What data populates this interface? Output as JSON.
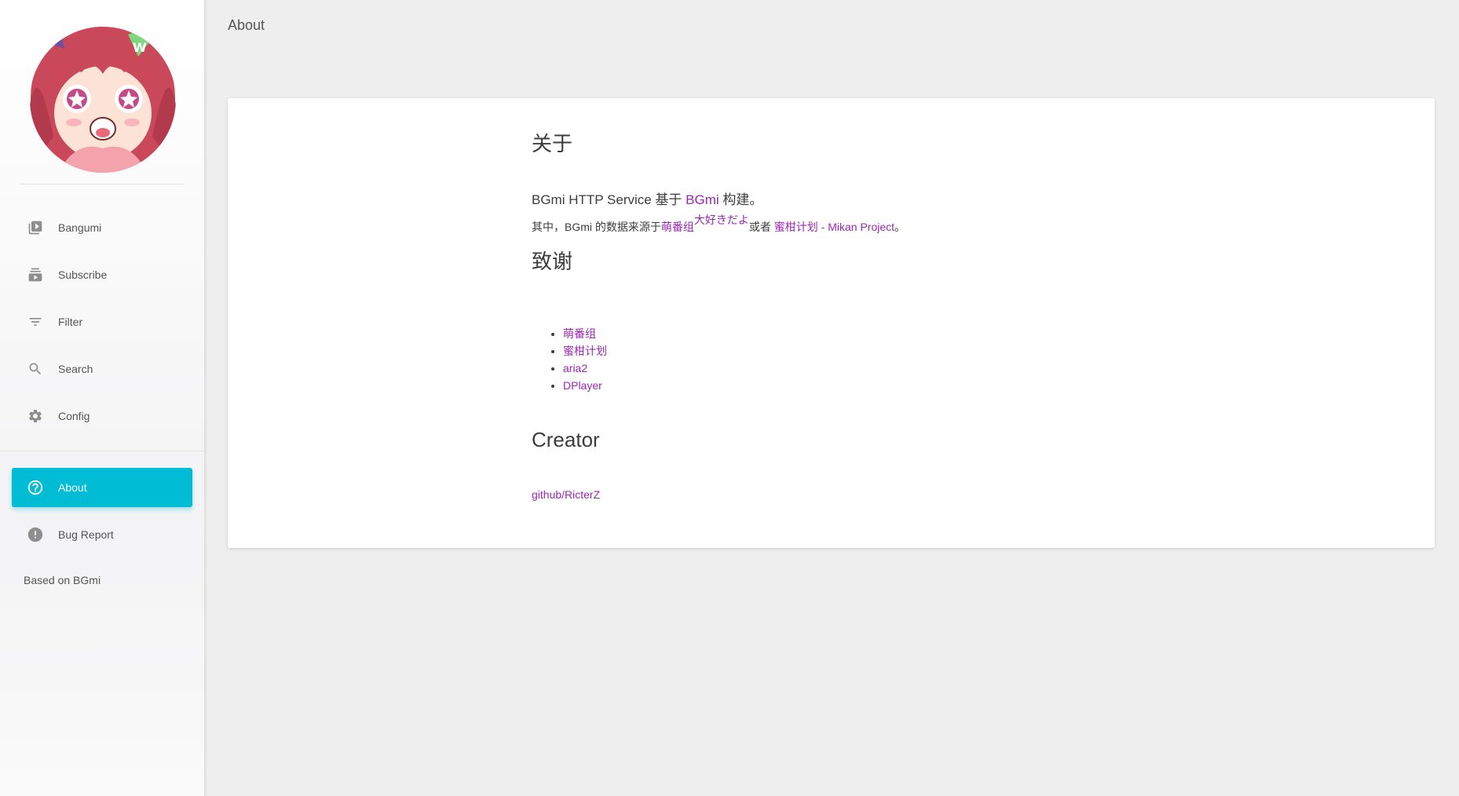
{
  "sidebar": {
    "items": [
      {
        "label": "Bangumi",
        "icon": "video-library-icon"
      },
      {
        "label": "Subscribe",
        "icon": "subscriptions-icon"
      },
      {
        "label": "Filter",
        "icon": "filter-icon"
      },
      {
        "label": "Search",
        "icon": "search-icon"
      },
      {
        "label": "Config",
        "icon": "gear-icon"
      }
    ],
    "bottom_items": [
      {
        "label": "About",
        "icon": "help-circle-icon",
        "active": true
      },
      {
        "label": "Bug Report",
        "icon": "error-icon",
        "active": false
      }
    ],
    "footer": "Based on BGmi",
    "active_color": "#00bcd4"
  },
  "header": {
    "title": "About"
  },
  "about": {
    "heading": "关于",
    "intro_prefix": "BGmi HTTP Service 基于 ",
    "intro_link": "BGmi",
    "intro_suffix": " 构建。",
    "source_prefix": "其中，BGmi 的数据来源于",
    "source_link1": "萌番组",
    "source_link1_sup": "大好きだよ",
    "source_middle": "或者 ",
    "source_link2": "蜜柑计划 - Mikan Project",
    "source_suffix": "。",
    "thanks_heading": "致谢",
    "thanks": [
      "萌番组",
      "蜜柑计划",
      "aria2",
      "DPlayer"
    ],
    "creator_heading": "Creator",
    "creator_link": "github/RicterZ",
    "link_color": "#9c27b0"
  }
}
